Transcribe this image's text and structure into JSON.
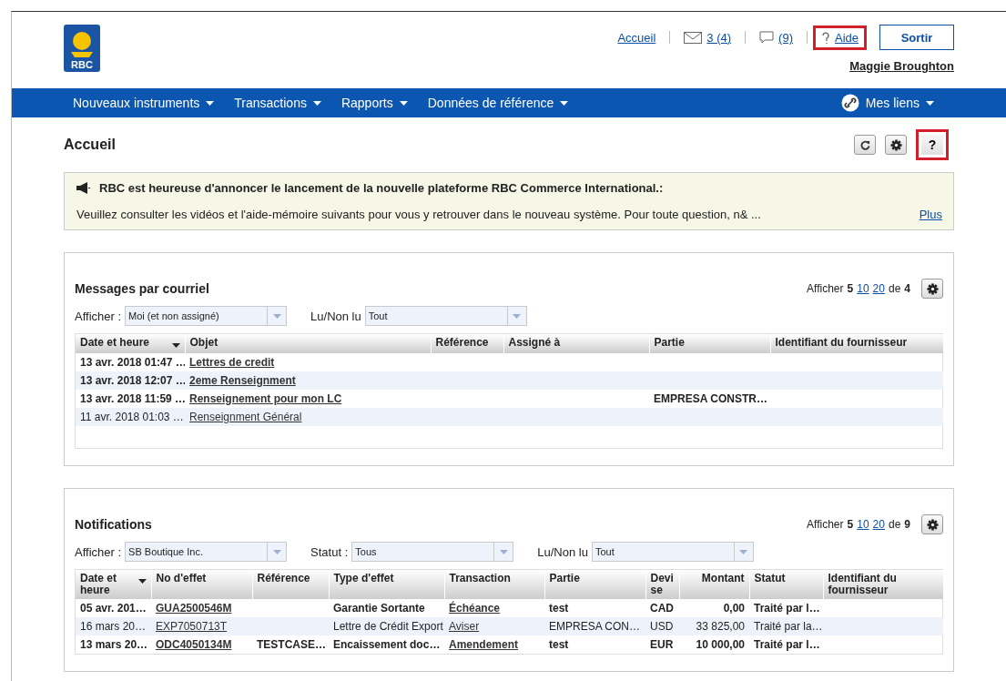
{
  "header": {
    "logo_text": "RBC",
    "links": [
      {
        "kind": "home",
        "label": "Accueil",
        "highlighted": false
      },
      {
        "kind": "mail",
        "label": "3 (4)",
        "highlighted": false
      },
      {
        "kind": "chat",
        "label": "(9)",
        "highlighted": false
      },
      {
        "kind": "help",
        "label": "Aide",
        "highlighted": true
      }
    ],
    "logout": "Sortir",
    "user": "Maggie Broughton"
  },
  "nav": {
    "items": [
      "Nouveaux instruments",
      "Transactions",
      "Rapports",
      "Données de référence"
    ],
    "my_links": "Mes liens"
  },
  "page": {
    "title": "Accueil",
    "tools": [
      {
        "kind": "refresh",
        "highlighted": false
      },
      {
        "kind": "settings",
        "highlighted": false
      },
      {
        "kind": "help",
        "label": "?",
        "highlighted": true
      }
    ]
  },
  "announcement": {
    "title": "RBC est heureuse d'annoncer le lancement de la nouvelle plateforme RBC Commerce International.:",
    "body": "Veuillez consulter les vidéos et l'aide-mémoire suivants pour vous y retrouver dans le nouveau système. Pour toute question, n& ...",
    "more": "Plus"
  },
  "panels": [
    {
      "title": "Messages par courriel",
      "pager": {
        "prefix": "Afficher",
        "options": [
          {
            "label": "5",
            "selected": true
          },
          {
            "label": "10",
            "selected": false
          },
          {
            "label": "20",
            "selected": false
          }
        ],
        "of": "de",
        "total": "4"
      },
      "filters": [
        {
          "label": "Afficher :",
          "value": "Moi (et non assigné)"
        },
        {
          "label": "Lu/Non lu",
          "value": "Tout"
        }
      ],
      "columns": [
        {
          "label": "Date et heure",
          "kind": "text",
          "sorted": true
        },
        {
          "label": "Objet",
          "kind": "link",
          "sorted": false
        },
        {
          "label": "Référence",
          "kind": "text",
          "sorted": false
        },
        {
          "label": "Assigné à",
          "kind": "text",
          "sorted": false
        },
        {
          "label": "Partie",
          "kind": "text",
          "sorted": false
        },
        {
          "label": "Identifiant du fournisseur",
          "kind": "text",
          "sorted": false
        }
      ],
      "rows": [
        {
          "unread": true,
          "cells": [
            "13 avr. 2018 01:47 …",
            "Lettres de credit",
            "",
            "",
            "",
            ""
          ]
        },
        {
          "unread": true,
          "cells": [
            "13 avr. 2018 12:07 …",
            "2eme Renseignment",
            "",
            "",
            "",
            ""
          ]
        },
        {
          "unread": true,
          "cells": [
            "13 avr. 2018 11:59 …",
            "Renseignement pour mon LC",
            "",
            "",
            "EMPRESA CONSTR…",
            ""
          ]
        },
        {
          "unread": false,
          "cells": [
            "11 avr. 2018 01:03 …",
            "Renseignment Général",
            "",
            "",
            "",
            ""
          ]
        }
      ]
    },
    {
      "title": "Notifications",
      "pager": {
        "prefix": "Afficher",
        "options": [
          {
            "label": "5",
            "selected": true
          },
          {
            "label": "10",
            "selected": false
          },
          {
            "label": "20",
            "selected": false
          }
        ],
        "of": "de",
        "total": "9"
      },
      "filters": [
        {
          "label": "Afficher :",
          "value": "SB Boutique Inc."
        },
        {
          "label": "Statut :",
          "value": "Tous"
        },
        {
          "label": "Lu/Non lu",
          "value": "Tout"
        }
      ],
      "columns": [
        {
          "label": "Date et heure",
          "kind": "text",
          "sorted": true
        },
        {
          "label": "No d'effet",
          "kind": "link",
          "sorted": false
        },
        {
          "label": "Référence",
          "kind": "text",
          "sorted": false
        },
        {
          "label": "Type d'effet",
          "kind": "text",
          "sorted": false
        },
        {
          "label": "Transaction",
          "kind": "link",
          "sorted": false
        },
        {
          "label": "Partie",
          "kind": "text",
          "sorted": false
        },
        {
          "label": "Devi se",
          "kind": "text",
          "sorted": false
        },
        {
          "label": "Montant",
          "kind": "number",
          "sorted": false
        },
        {
          "label": "Statut",
          "kind": "text",
          "sorted": false
        },
        {
          "label": "Identifiant du fournisseur",
          "kind": "text",
          "sorted": false
        }
      ],
      "rows": [
        {
          "unread": true,
          "cells": [
            "05 avr. 201…",
            "GUA2500546M",
            "",
            "Garantie Sortante",
            "Échéance",
            "test",
            "CAD",
            "0,00",
            "Traité par l…",
            ""
          ]
        },
        {
          "unread": false,
          "cells": [
            "16 mars 20…",
            "EXP7050713T",
            "",
            "Lettre de Crédit Export",
            "Aviser",
            "EMPRESA CON…",
            "USD",
            "33 825,00",
            "Traité par la…",
            ""
          ]
        },
        {
          "unread": true,
          "cells": [
            "13 mars 20…",
            "ODC4050134M",
            "TESTCASE…",
            "Encaissement doc…",
            "Amendement",
            "test",
            "EUR",
            "10 000,00",
            "Traité par l…",
            ""
          ]
        }
      ]
    }
  ]
}
